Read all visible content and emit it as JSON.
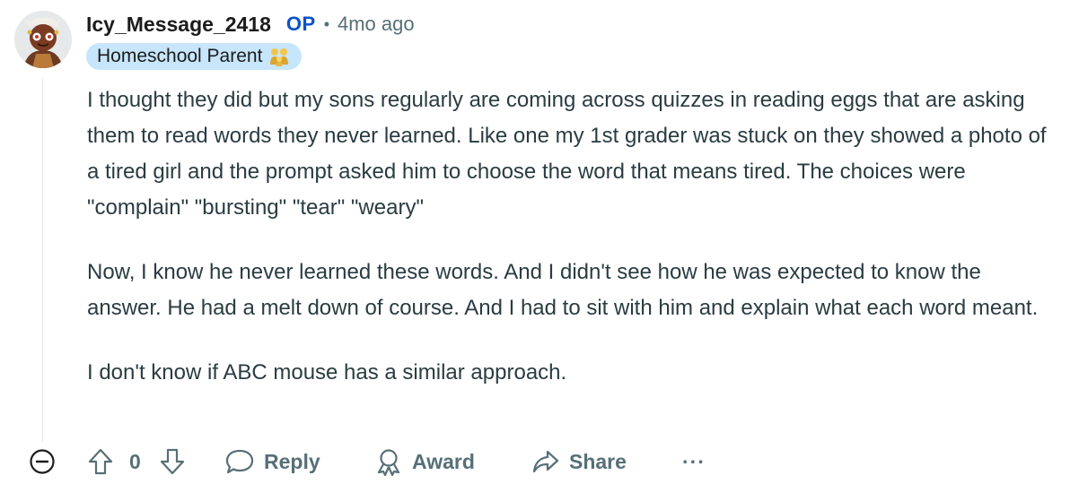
{
  "comment": {
    "username": "Icy_Message_2418",
    "op_badge": "OP",
    "separator": "•",
    "timestamp": "4mo ago",
    "flair": "Homeschool Parent",
    "flair_emoji": "family-emoji-icon",
    "avatar": "snoo-avatar",
    "paragraphs": [
      "I thought they did but my sons regularly are coming across quizzes in reading eggs that are asking them to read words they never learned. Like one my 1st grader was stuck on they showed a photo of a tired girl and the prompt asked him to choose the word that means tired. The choices were \"complain\" \"bursting\" \"tear\" \"weary\"",
      "Now, I know he never learned these words. And I didn't see how he was expected to know the answer. He had a melt down of course. And I had to sit with him and explain what each word meant.",
      "I don't know if ABC mouse has a similar approach."
    ]
  },
  "actions": {
    "collapse_icon": "minus-circle-icon",
    "upvote_icon": "arrow-up-icon",
    "vote_count": "0",
    "downvote_icon": "arrow-down-icon",
    "reply_label": "Reply",
    "award_label": "Award",
    "share_label": "Share",
    "more_label": "···"
  },
  "colors": {
    "meta_text": "#576f76",
    "op_accent": "#0a52c6",
    "flair_bg": "#c7e6fb",
    "body_text": "#2a3c42"
  }
}
